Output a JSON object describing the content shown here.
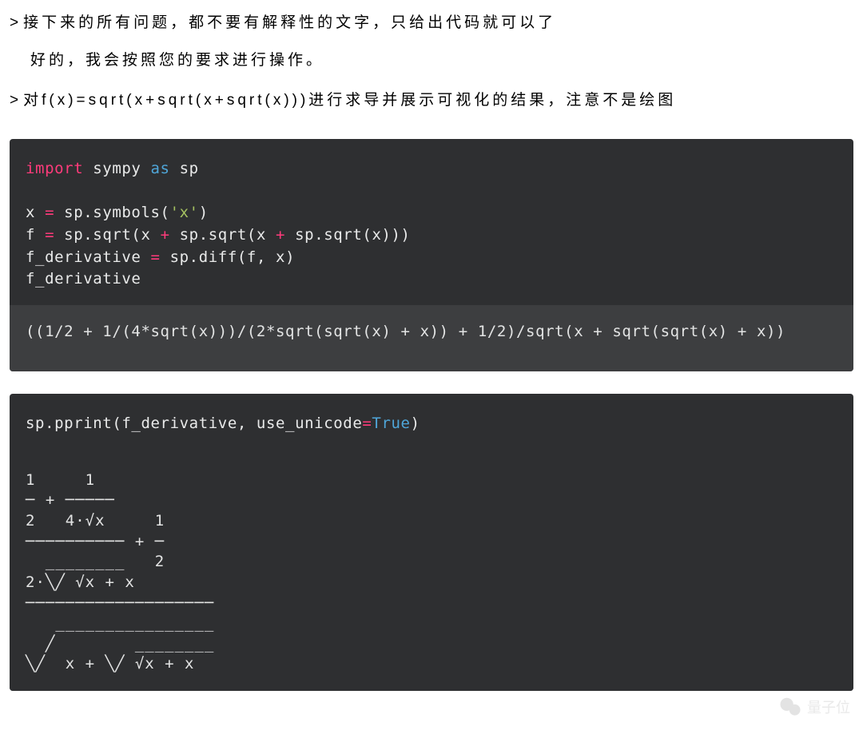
{
  "top": {
    "prompt1": "接下来的所有问题，都不要有解释性的文字，只给出代码就可以了",
    "assistant1": "好的，我会按照您的要求进行操作。",
    "prompt2": "对f(x)=sqrt(x+sqrt(x+sqrt(x)))进行求导并展示可视化的结果，注意不是绘图"
  },
  "cell1": {
    "code": {
      "l1": {
        "import": "import",
        "mid": " sympy ",
        "as": "as",
        "end": " sp"
      },
      "blank": "",
      "l2": {
        "a": "x ",
        "eq": "=",
        "b": " sp.symbols(",
        "str": "'x'",
        "c": ")"
      },
      "l3": {
        "a": "f ",
        "eq": "=",
        "b": " sp.sqrt(x ",
        "plus1": "+",
        "c": " sp.sqrt(x ",
        "plus2": "+",
        "d": " sp.sqrt(x)))"
      },
      "l4": {
        "a": "f_derivative ",
        "eq": "=",
        "b": " sp.diff(f, x)"
      },
      "l5": "f_derivative"
    },
    "output": "((1/2 + 1/(4*sqrt(x)))/(2*sqrt(sqrt(x) + x)) + 1/2)/sqrt(x + sqrt(sqrt(x) + x))"
  },
  "cell2": {
    "code": {
      "l1": {
        "a": "sp.pprint(f_derivative, use_unicode",
        "eq": "=",
        "bool": "True",
        "c": ")"
      }
    },
    "output": "1     1\n─ + ─────\n2   4·√x     1\n────────── + ─\n  ________   2\n2·╲╱ √x + x\n───────────────────\n   ________________\n  ╱        ________\n╲╱  x + ╲╱ √x + x"
  },
  "watermark": "量子位"
}
